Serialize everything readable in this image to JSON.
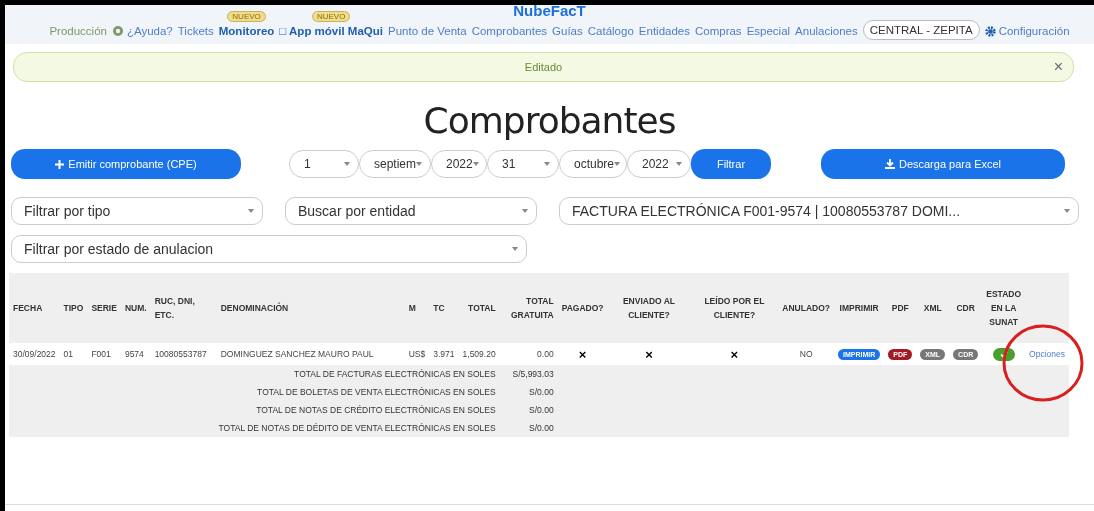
{
  "logo": "NubeFacT",
  "nav": [
    {
      "label": "Producción",
      "kind": "muted"
    },
    {
      "label": "¿Ayuda?",
      "kind": "help"
    },
    {
      "label": "Tickets",
      "kind": "link"
    },
    {
      "label": "Monitoreo",
      "kind": "featured",
      "badge": "NUEVO"
    },
    {
      "label": "□ App móvil MaQui",
      "kind": "featured",
      "badge": "NUEVO"
    },
    {
      "label": "Punto de Venta",
      "kind": "link"
    },
    {
      "label": "Comprobantes",
      "kind": "link"
    },
    {
      "label": "Guías",
      "kind": "link"
    },
    {
      "label": "Catálogo",
      "kind": "link"
    },
    {
      "label": "Entidades",
      "kind": "link"
    },
    {
      "label": "Compras",
      "kind": "link"
    },
    {
      "label": "Especial",
      "kind": "link"
    },
    {
      "label": "Anulaciones",
      "kind": "link"
    },
    {
      "label": "CENTRAL - ZEPITA",
      "kind": "branch"
    },
    {
      "label": "Configuración",
      "kind": "settings"
    }
  ],
  "alert": {
    "text": "Editado",
    "close": "×"
  },
  "title": "Comprobantes",
  "emit_button": "Emitir comprobante (CPE)",
  "date_selects": [
    "1",
    "septiem",
    "2022",
    "31",
    "octubre",
    "2022"
  ],
  "filter_button": "Filtrar",
  "excel_button": "Descarga para Excel",
  "filters": [
    "Filtrar por tipo",
    "Buscar por entidad",
    "FACTURA ELECTRÓNICA F001-9574 | 10080553787 DOMI...",
    "Filtrar por estado de anulacion"
  ],
  "table": {
    "columns": [
      "FECHA",
      "TIPO",
      "SERIE",
      "NUM.",
      "RUC, DNI, ETC.",
      "DENOMINACIÓN",
      "M",
      "TC",
      "TOTAL",
      "TOTAL GRATUITA",
      "PAGADO?",
      "ENVIADO AL CLIENTE?",
      "LEÍDO POR EL CLIENTE?",
      "ANULADO?",
      "IMPRIMIR",
      "PDF",
      "XML",
      "CDR",
      "ESTADO EN LA SUNAT",
      ""
    ],
    "rows": [
      {
        "fecha": "30/09/2022",
        "tipo": "01",
        "serie": "F001",
        "num": "9574",
        "ruc": "10080553787",
        "denominacion": "DOMINGUEZ SANCHEZ MAURO PAUL",
        "m": "US$",
        "tc": "3.971",
        "total": "1,509.20",
        "gratuita": "0.00",
        "pagado": "×",
        "enviado": "×",
        "leido": "×",
        "anulado": "NO",
        "imprimir": "IMPRIMIR",
        "pdf": "PDF",
        "xml": "XML",
        "cdr": "CDR",
        "sunat_accepted": true,
        "options": "Opciones"
      }
    ],
    "totals": [
      {
        "label": "TOTAL DE FACTURAS ELECTRÓNICAS EN SOLES",
        "value": "S/5,993.03"
      },
      {
        "label": "TOTAL DE BOLETAS DE VENTA ELECTRÓNICAS EN SOLES",
        "value": "S/0.00"
      },
      {
        "label": "TOTAL DE NOTAS DE CRÉDITO ELECTRÓNICAS EN SOLES",
        "value": "S/0.00"
      },
      {
        "label": "TOTAL DE NOTAS DE DÉDITO DE VENTA ELECTRÓNICAS EN SOLES",
        "value": "S/0.00"
      }
    ]
  }
}
